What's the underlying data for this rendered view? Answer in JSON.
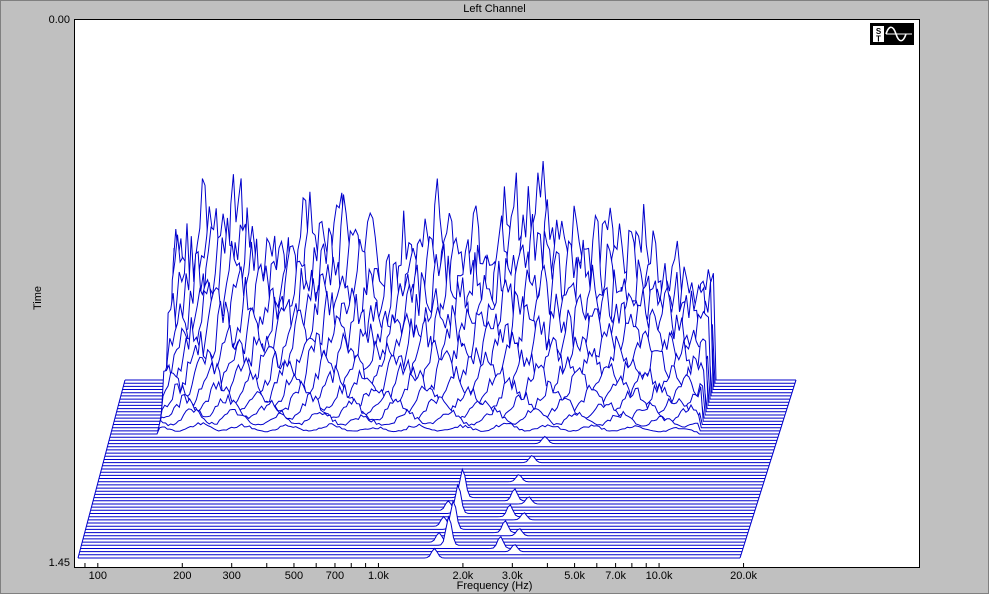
{
  "chart_data": {
    "type": "line",
    "title": "Left Channel",
    "xlabel": "Frequency (Hz)",
    "ylabel": "Time",
    "y_ticks": [
      "0.00",
      "1.45"
    ],
    "x_ticks": [
      "100",
      "200",
      "300",
      "500",
      "700",
      "1.0k",
      "2.0k",
      "3.0k",
      "5.0k",
      "7.0k",
      "10.0k",
      "20.0k"
    ],
    "x_scale": "log",
    "xlim": [
      85,
      30000
    ],
    "ylim": [
      0,
      1.45
    ],
    "series_color": "#0000cc",
    "waterfall_slices": 57,
    "front_slice_peaks": [
      {
        "x": 2000,
        "y": 0.04
      },
      {
        "x": 2200,
        "y": 0.12
      },
      {
        "x": 3500,
        "y": 0.05
      },
      {
        "x": 4000,
        "y": 0.03
      }
    ],
    "rear_slice_peaks": [
      {
        "x": 200,
        "y": 0.8
      },
      {
        "x": 500,
        "y": 0.75
      },
      {
        "x": 1400,
        "y": 0.75
      },
      {
        "x": 3000,
        "y": 0.82
      },
      {
        "x": 4500,
        "y": 0.7
      },
      {
        "x": 7000,
        "y": 0.65
      },
      {
        "x": 12000,
        "y": 0.5
      },
      {
        "x": 20000,
        "y": 0.35
      }
    ]
  }
}
